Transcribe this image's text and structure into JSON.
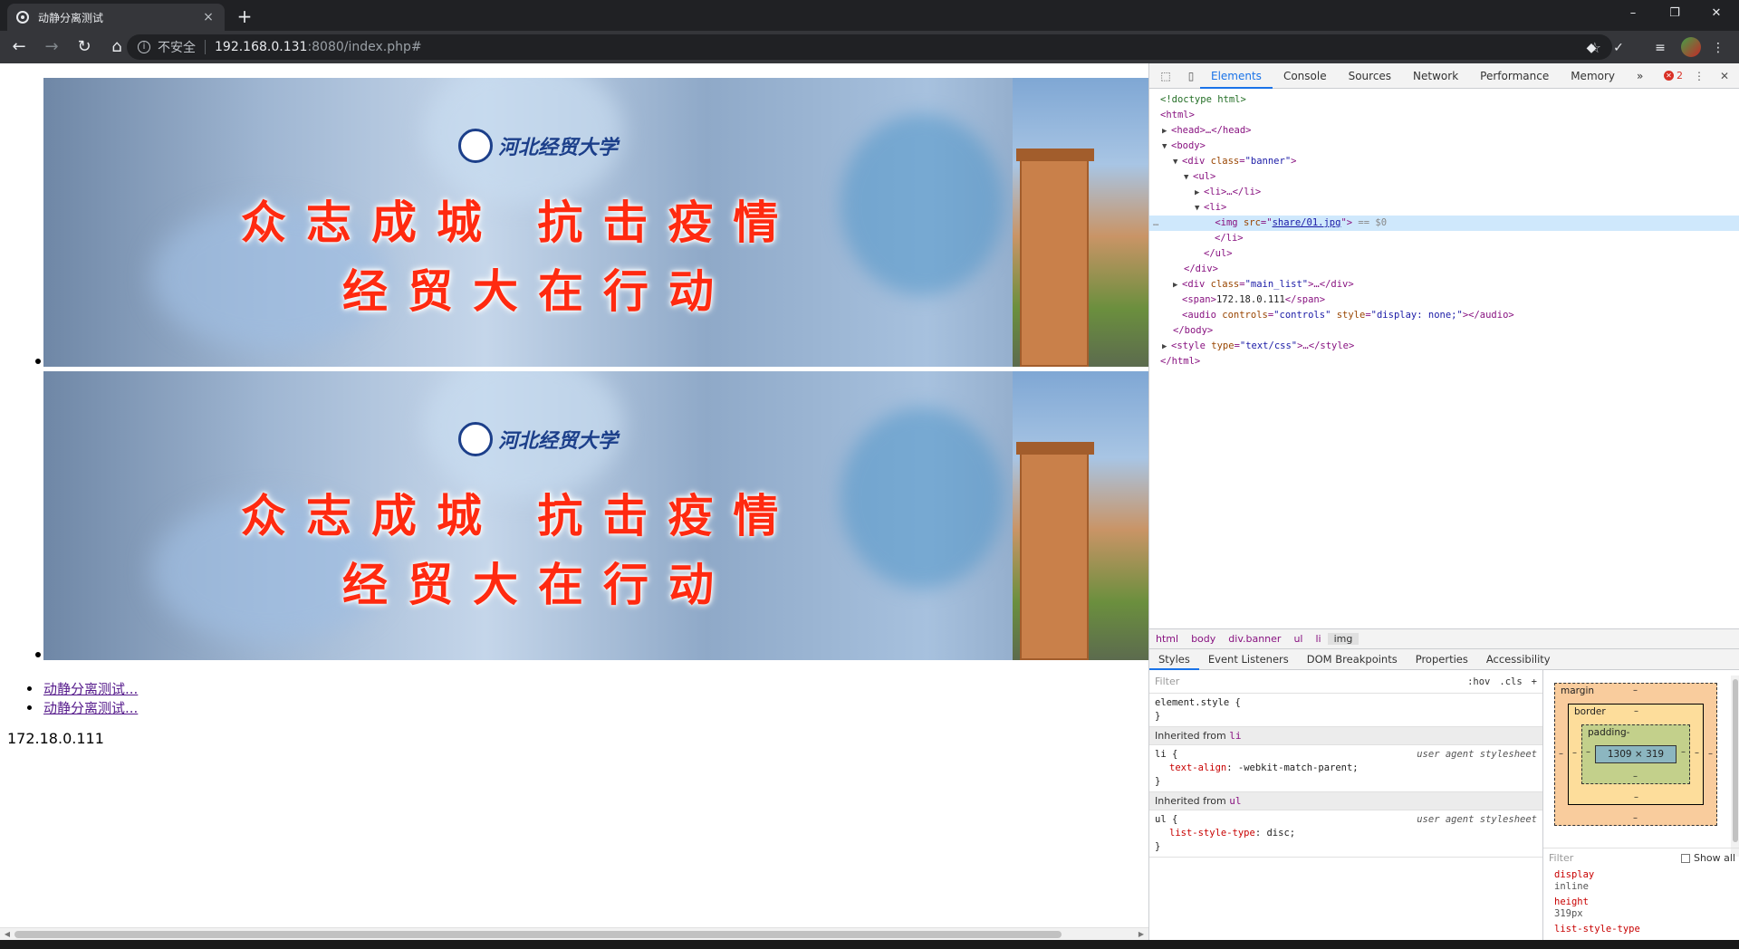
{
  "browser": {
    "tab_title": "动静分离测试",
    "tab_close": "×",
    "new_tab": "+",
    "window_controls": [
      "–",
      "❐",
      "✕"
    ],
    "insecure_label": "不安全",
    "url_host": "192.168.0.131",
    "url_rest": ":8080/index.php#",
    "icons": [
      "back-icon",
      "forward-icon",
      "reload-icon",
      "home-icon",
      "info-icon",
      "star-icon"
    ]
  },
  "page": {
    "banner": {
      "logo_text": "河北经贸大学",
      "headline_1": "众志成城 抗击疫情",
      "headline_2": "经贸大在行动"
    },
    "links": [
      "动静分离测试...",
      "动静分离测试..."
    ],
    "ip": "172.18.0.111"
  },
  "devtools": {
    "tabs": [
      "Elements",
      "Console",
      "Sources",
      "Network",
      "Performance",
      "Memory"
    ],
    "more_tabs": "»",
    "error_count": "2",
    "dom": {
      "l1": "<!doctype html>",
      "l2": "<html>",
      "l3": "<head>…</head>",
      "l4": "<body>",
      "l5_tag": "div",
      "l5_attr": "class",
      "l5_val": "\"banner\"",
      "l6": "<ul>",
      "l7": "<li>…</li>",
      "l8": "<li>",
      "l9_tag": "img",
      "l9_attr": "src",
      "l9_val": "share/01.jpg",
      "l9_sel": "== $0",
      "l10": "</li>",
      "l11": "</ul>",
      "l12": "</div>",
      "l13_tag": "div",
      "l13_attr": "class",
      "l13_val": "\"main_list\"",
      "l13_end": ">…</div>",
      "l14_text": "172.18.0.111",
      "l15_tag": "audio",
      "l15_attr1": "controls",
      "l15_val1": "\"controls\"",
      "l15_attr2": "style",
      "l15_val2": "\"display: none;\"",
      "l15_end": "></audio>",
      "l16": "</body>",
      "l17_tag": "style",
      "l17_attr": "type",
      "l17_val": "\"text/css\"",
      "l17_end": ">…</style>",
      "l18": "</html>"
    },
    "breadcrumbs": [
      "html",
      "body",
      "div.banner",
      "ul",
      "li",
      "img"
    ],
    "subtabs": [
      "Styles",
      "Event Listeners",
      "DOM Breakpoints",
      "Properties",
      "Accessibility"
    ],
    "styles": {
      "filter_placeholder": "Filter",
      "hov": ":hov",
      "cls": ".cls",
      "add": "+",
      "element_style": "element.style {",
      "close_brace": "}",
      "inherited_li_label": "Inherited from",
      "inherited_li_tag": "li",
      "li_selector": "li {",
      "li_source": "user agent stylesheet",
      "li_prop": "text-align",
      "li_val": "-webkit-match-parent;",
      "inherited_ul_tag": "ul",
      "ul_selector": "ul {",
      "ul_source": "user agent stylesheet",
      "ul_prop": "list-style-type",
      "ul_val": "disc;"
    },
    "boxmodel": {
      "margin": "margin",
      "border": "border",
      "padding": "padding-",
      "dash": "–",
      "content": "1309 × 319"
    },
    "computed": {
      "filter_placeholder": "Filter",
      "show_all": "Show all",
      "props": [
        {
          "name": "display",
          "value": "inline"
        },
        {
          "name": "height",
          "value": "319px"
        },
        {
          "name": "list-style-type",
          "value": ""
        }
      ]
    }
  }
}
